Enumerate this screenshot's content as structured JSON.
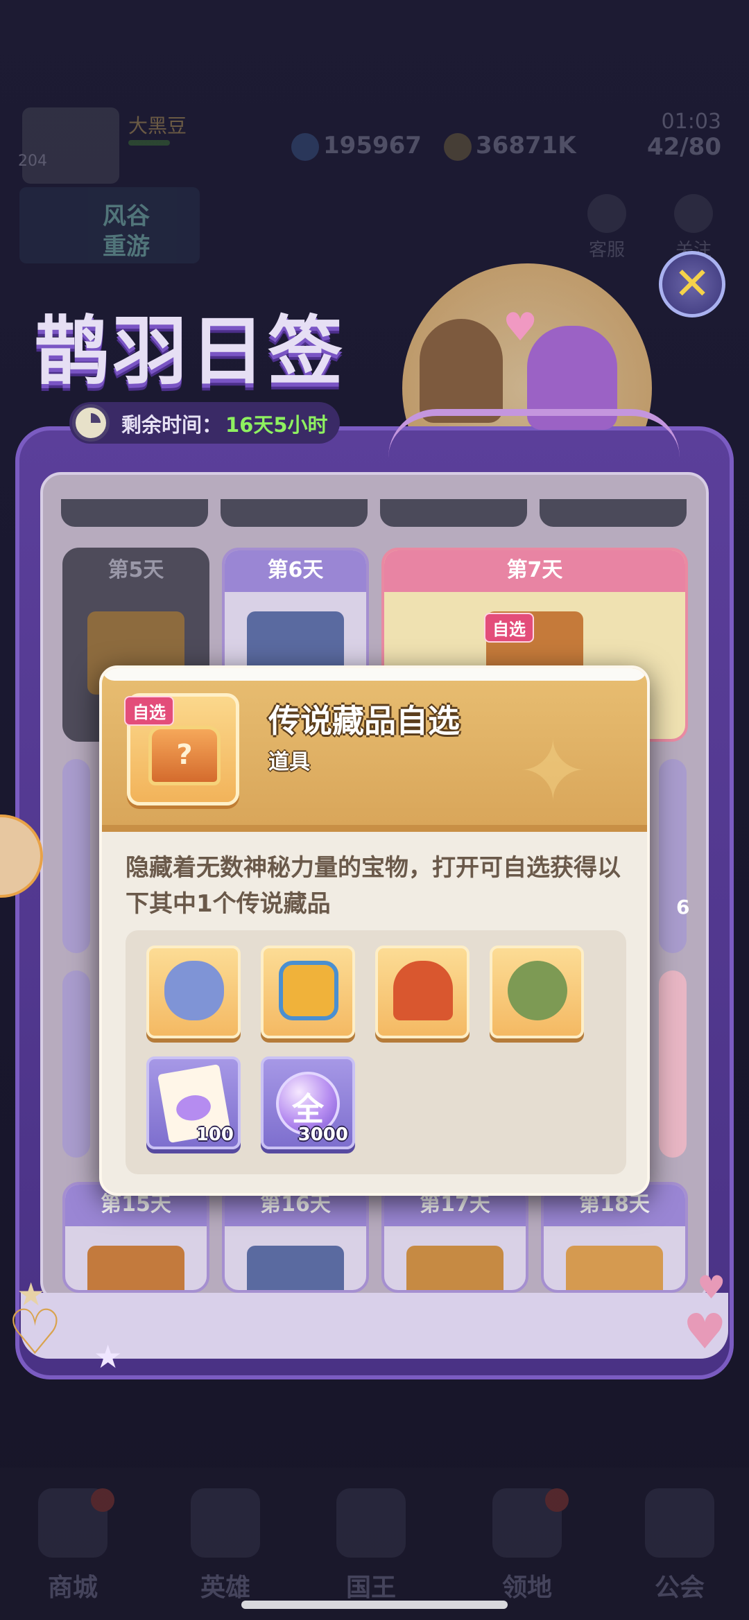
{
  "hud": {
    "player_name": "大黑豆",
    "level": "204",
    "gems": "195967",
    "gold": "36871K",
    "timer": "01:03",
    "energy": "42/80",
    "banner_line1": "风谷",
    "banner_line2": "重游",
    "side_btn_1": "客服",
    "side_btn_2": "关注"
  },
  "event": {
    "title": "鹊羽日签",
    "remaining_label": "剩余时间：",
    "remaining_value": "16天5小时",
    "days": {
      "d5": "第5天",
      "d6": "第6天",
      "d7": "第7天",
      "d15": "第15天",
      "d16": "第16天",
      "d17": "第17天",
      "d18": "第18天"
    },
    "day7_tag": "自选",
    "side_count": "6"
  },
  "modal": {
    "tag": "自选",
    "title": "传说藏品自选",
    "subtitle": "道具",
    "description": "隐藏着无数神秘力量的宝物，打开可自选获得以下其中1个传说藏品",
    "rewards": [
      {
        "icon": "blue-bear-plush-icon",
        "qty": ""
      },
      {
        "icon": "retro-tv-icon",
        "qty": ""
      },
      {
        "icon": "golden-trophy-icon",
        "qty": ""
      },
      {
        "icon": "moss-golem-icon",
        "qty": ""
      },
      {
        "icon": "integral-card-icon",
        "qty": "100"
      },
      {
        "icon": "all-orb-icon",
        "label": "全",
        "qty": "3000"
      }
    ]
  },
  "nav": {
    "shop": "商城",
    "heroes": "英雄",
    "king": "国王",
    "territory": "领地",
    "guild": "公会"
  },
  "colors": {
    "accent_green": "#8ef060",
    "modal_header": "#e8be72",
    "tag_pink": "#e34d7a",
    "panel_purple": "#5b3f9a"
  }
}
